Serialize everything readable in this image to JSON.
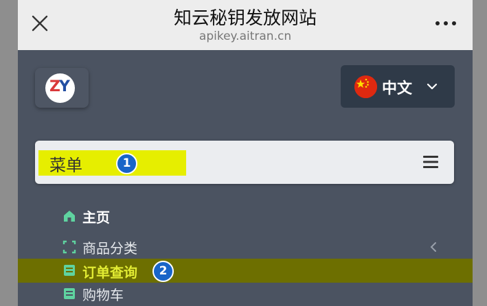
{
  "titlebar": {
    "title": "知云秘钥发放网站",
    "url": "apikey.aitran.cn",
    "close_icon": "close-icon",
    "more_icon": "more-icon"
  },
  "header": {
    "logo_left": "Z",
    "logo_right": "Y",
    "language": "中文",
    "flag_icon": "china-flag-icon"
  },
  "menu": {
    "label": "菜单",
    "badge": "1",
    "hamburger_icon": "hamburger-icon"
  },
  "nav": {
    "items": [
      {
        "label": "主页",
        "icon": "home-icon"
      },
      {
        "label": "商品分类",
        "icon": "expand-icon"
      },
      {
        "label": "订单查询",
        "icon": "order-icon",
        "badge": "2"
      },
      {
        "label": "购物车",
        "icon": "cart-icon"
      }
    ]
  },
  "colors": {
    "highlight_yellow": "#e6ee00",
    "selected_row": "#6d6f00",
    "badge_blue": "#1865c8",
    "dark_bg": "#4b5361",
    "icon_green": "#5fd3a0"
  }
}
